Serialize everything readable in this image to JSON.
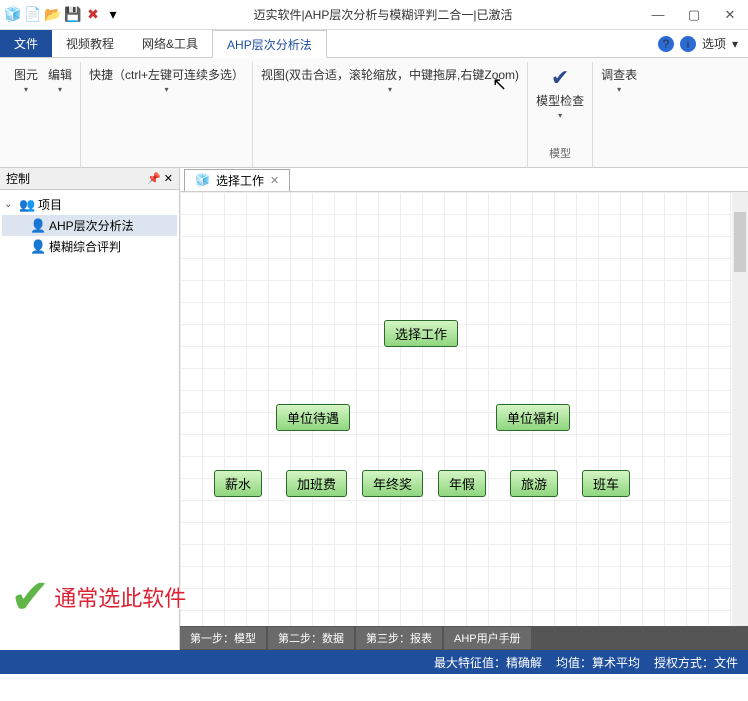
{
  "title": "迈实软件|AHP层次分析与模糊评判二合一|已激活",
  "qat": {
    "i1": "🧊",
    "i2": "📄",
    "i3": "📂",
    "i4": "💾",
    "i5": "✖",
    "i6": "▾"
  },
  "win": {
    "min": "—",
    "max": "▢",
    "close": "✕"
  },
  "tabs": {
    "file": "文件",
    "t1": "视频教程",
    "t2": "网络&工具",
    "t3": "AHP层次分析法",
    "opts": "选项",
    "optsdd": "▾"
  },
  "ribbon": {
    "g1": {
      "a": "图元",
      "b": "编辑"
    },
    "g2": {
      "a": "快捷（ctrl+左键可连续多选）"
    },
    "g3": {
      "a": "视图(双击合适，滚轮缩放，中键拖屏,右键Zoom)"
    },
    "g4": {
      "a": "模型检查",
      "lbl": "模型"
    },
    "g5": {
      "a": "调查表"
    }
  },
  "side": {
    "title": "控制",
    "root": "项目",
    "c1": "AHP层次分析法",
    "c2": "模糊综合评判"
  },
  "doctab": {
    "title": "选择工作"
  },
  "diagram": {
    "root": "选择工作",
    "l2a": "单位待遇",
    "l2b": "单位福利",
    "l3a": "薪水",
    "l3b": "加班费",
    "l3c": "年终奖",
    "l3d": "年假",
    "l3e": "旅游",
    "l3f": "班车"
  },
  "steps": {
    "s1": "第一步：模型",
    "s2": "第二步：数据",
    "s3": "第三步：报表",
    "s4": "AHP用户手册"
  },
  "status": {
    "a": "最大特征值：精确解",
    "b": "均值：算术平均",
    "c": "授权方式：文件"
  },
  "annot": "通常选此软件"
}
